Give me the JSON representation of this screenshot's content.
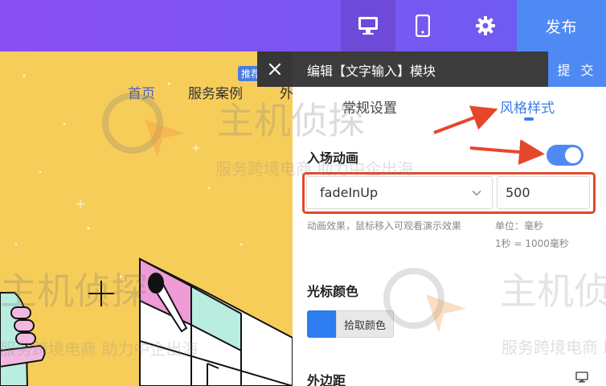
{
  "topbar": {
    "desktop_icon": "desktop-icon",
    "mobile_icon": "mobile-icon",
    "settings_icon": "gear-icon",
    "publish_label": "发布"
  },
  "preview": {
    "nav": {
      "home": "首页",
      "cases": "服务案例",
      "more": "外"
    },
    "recommend_tag": "推荐",
    "close_icon": "close-icon"
  },
  "panel": {
    "title": "编辑【文字输入】模块",
    "submit_label": "提 交",
    "tabs": [
      {
        "label": "常规设置"
      },
      {
        "label": "风格样式",
        "active": true
      }
    ],
    "entry_animation": {
      "label": "入场动画",
      "enabled": true,
      "effect_value": "fadeInUp",
      "duration_value": "500",
      "effect_hint": "动画效果，鼠标移入可观看演示效果",
      "unit_hint": "单位：毫秒",
      "conversion_hint": "1秒 = 1000毫秒"
    },
    "cursor_color": {
      "label": "光标颜色",
      "color": "#2d7cf0",
      "pick_label": "拾取颜色"
    },
    "margin": {
      "label": "外边距",
      "device_icon": "desktop-icon"
    }
  },
  "watermark": {
    "brand": "主机侦探",
    "slogan": "服务跨境电商 助力中企出海"
  },
  "colors": {
    "topbar": "#7a56f2",
    "accent": "#4f8af4",
    "panel_header": "#3c3c3c",
    "highlight": "#e04a2c",
    "canvas": "#f7cd5a"
  }
}
